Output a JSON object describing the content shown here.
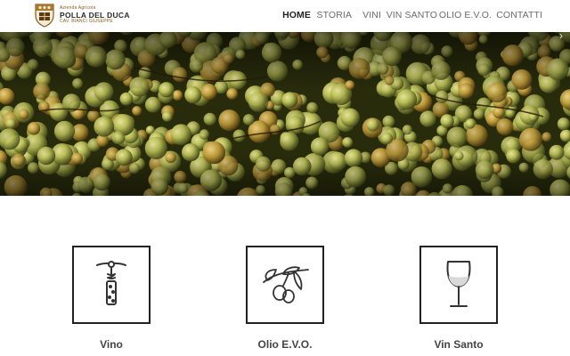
{
  "brand": {
    "small": "Azienda Agricola",
    "name": "POLLA DEL DUCA",
    "sub": "CAV. BIANCI GIUSEPPE"
  },
  "nav": [
    {
      "label": "HOME",
      "active": true
    },
    {
      "label": "STORIA",
      "active": false
    },
    {
      "label": "VINI",
      "active": false
    },
    {
      "label": "VIN SANTO",
      "active": false
    },
    {
      "label": "OLIO E.V.O.",
      "active": false
    },
    {
      "label": "CONTATTI",
      "active": false
    }
  ],
  "slider": {
    "slides": 4,
    "current": 1,
    "image": "white-grapes-harvest"
  },
  "features": [
    {
      "label": "Vino",
      "icon": "corkscrew-icon"
    },
    {
      "label": "Olio E.V.O.",
      "icon": "olive-branch-icon"
    },
    {
      "label": "Vin Santo",
      "icon": "wine-glass-icon"
    }
  ],
  "colors": {
    "accent": "#8a5a1c",
    "text_dark": "#222222",
    "nav_text": "#6b6b6b"
  }
}
